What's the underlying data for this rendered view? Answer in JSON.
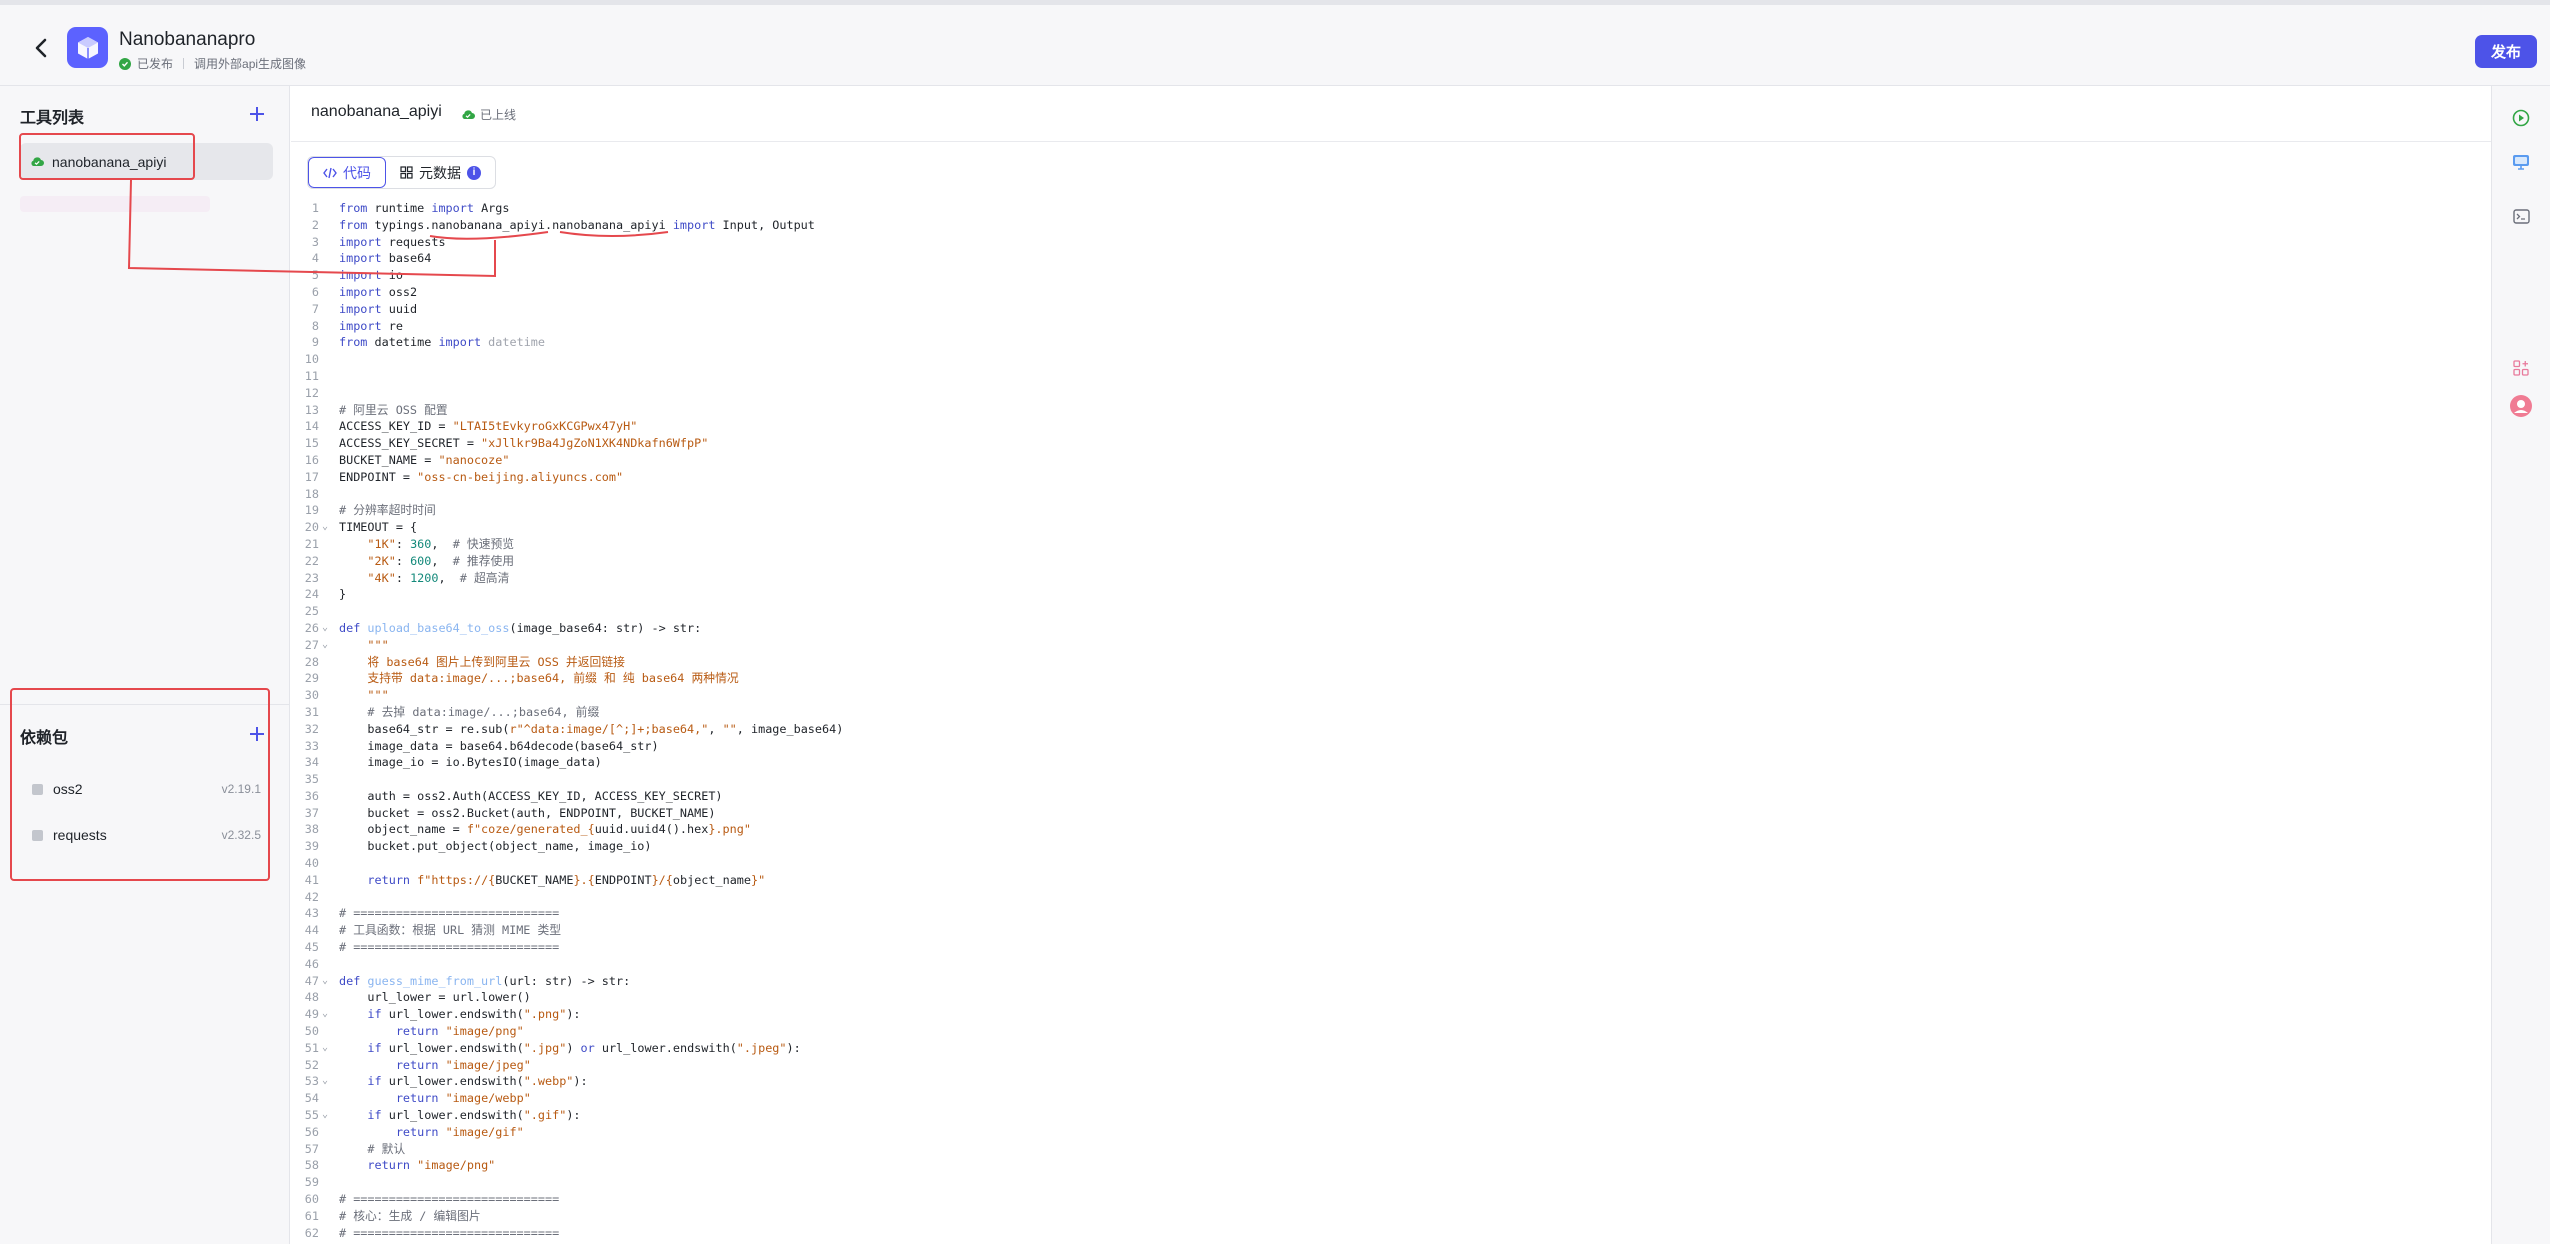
{
  "header": {
    "app_name": "Nanobananapro",
    "status_published": "已发布",
    "description": "调用外部api生成图像",
    "publish_label": "发布"
  },
  "sidebar": {
    "tools_title": "工具列表",
    "tools": [
      {
        "name": "nanobanana_apiyi"
      }
    ],
    "deps_title": "依赖包",
    "deps": [
      {
        "name": "oss2",
        "version": "v2.19.1"
      },
      {
        "name": "requests",
        "version": "v2.32.5"
      }
    ]
  },
  "editor": {
    "tool_name": "nanobanana_apiyi",
    "tool_status": "已上线",
    "tabs": [
      {
        "label": "代码"
      },
      {
        "label": "元数据"
      }
    ],
    "code_lines": [
      [
        [
          "kw",
          "from"
        ],
        [
          "t",
          " runtime "
        ],
        [
          "kw",
          "import"
        ],
        [
          "t",
          " Args"
        ]
      ],
      [
        [
          "kw",
          "from"
        ],
        [
          "t",
          " typings.nanobanana_apiyi.nanobanana_apiyi "
        ],
        [
          "kw",
          "import"
        ],
        [
          "t",
          " Input, Output"
        ]
      ],
      [
        [
          "kw",
          "import"
        ],
        [
          "t",
          " requests"
        ]
      ],
      [
        [
          "kw",
          "import"
        ],
        [
          "t",
          " base64"
        ]
      ],
      [
        [
          "kw",
          "import"
        ],
        [
          "t",
          " io"
        ]
      ],
      [
        [
          "kw",
          "import"
        ],
        [
          "t",
          " oss2"
        ]
      ],
      [
        [
          "kw",
          "import"
        ],
        [
          "t",
          " uuid"
        ]
      ],
      [
        [
          "kw",
          "import"
        ],
        [
          "t",
          " re"
        ]
      ],
      [
        [
          "kw",
          "from"
        ],
        [
          "t",
          " datetime "
        ],
        [
          "kw",
          "import"
        ],
        [
          "dim",
          " datetime"
        ]
      ],
      [],
      [],
      [],
      [
        [
          "cmt",
          "# 阿里云 OSS 配置"
        ]
      ],
      [
        [
          "t",
          "ACCESS_KEY_ID = "
        ],
        [
          "str",
          "\"LTAI5tEvkyroGxKCGPwx47yH\""
        ]
      ],
      [
        [
          "t",
          "ACCESS_KEY_SECRET = "
        ],
        [
          "str",
          "\"xJllkr9Ba4JgZoN1XK4NDkafn6WfpP\""
        ]
      ],
      [
        [
          "t",
          "BUCKET_NAME = "
        ],
        [
          "str",
          "\"nanocoze\""
        ]
      ],
      [
        [
          "t",
          "ENDPOINT = "
        ],
        [
          "str",
          "\"oss-cn-beijing.aliyuncs.com\""
        ]
      ],
      [],
      [
        [
          "cmt",
          "# 分辨率超时时间"
        ]
      ],
      [
        [
          "t",
          "TIMEOUT = {"
        ]
      ],
      [
        [
          "t",
          "    "
        ],
        [
          "str",
          "\"1K\""
        ],
        [
          "t",
          ": "
        ],
        [
          "num",
          "360"
        ],
        [
          "t",
          ",  "
        ],
        [
          "cmt",
          "# 快速预览"
        ]
      ],
      [
        [
          "t",
          "    "
        ],
        [
          "str",
          "\"2K\""
        ],
        [
          "t",
          ": "
        ],
        [
          "num",
          "600"
        ],
        [
          "t",
          ",  "
        ],
        [
          "cmt",
          "# 推荐使用"
        ]
      ],
      [
        [
          "t",
          "    "
        ],
        [
          "str",
          "\"4K\""
        ],
        [
          "t",
          ": "
        ],
        [
          "num",
          "1200"
        ],
        [
          "t",
          ",  "
        ],
        [
          "cmt",
          "# 超高清"
        ]
      ],
      [
        [
          "t",
          "}"
        ]
      ],
      [],
      [
        [
          "kw",
          "def"
        ],
        [
          "t",
          " "
        ],
        [
          "fn",
          "upload_base64_to_oss"
        ],
        [
          "t",
          "(image_base64: str) -> str:"
        ]
      ],
      [
        [
          "t",
          "    "
        ],
        [
          "str",
          "\"\"\""
        ]
      ],
      [
        [
          "t",
          "    "
        ],
        [
          "str",
          "将 base64 图片上传到阿里云 OSS 并返回链接"
        ]
      ],
      [
        [
          "t",
          "    "
        ],
        [
          "str",
          "支持带 data:image/...;base64, 前缀 和 纯 base64 两种情况"
        ]
      ],
      [
        [
          "t",
          "    "
        ],
        [
          "str",
          "\"\"\""
        ]
      ],
      [
        [
          "t",
          "    "
        ],
        [
          "cmt",
          "# 去掉 data:image/...;base64, 前缀"
        ]
      ],
      [
        [
          "t",
          "    base64_str = re.sub("
        ],
        [
          "str",
          "r\"^data:image/[^;]+;base64,\""
        ],
        [
          "t",
          ", "
        ],
        [
          "str",
          "\"\""
        ],
        [
          "t",
          ", image_base64)"
        ]
      ],
      [
        [
          "t",
          "    image_data = base64.b64decode(base64_str)"
        ]
      ],
      [
        [
          "t",
          "    image_io = io.BytesIO(image_data)"
        ]
      ],
      [],
      [
        [
          "t",
          "    auth = oss2.Auth(ACCESS_KEY_ID, ACCESS_KEY_SECRET)"
        ]
      ],
      [
        [
          "t",
          "    bucket = oss2.Bucket(auth, ENDPOINT, BUCKET_NAME)"
        ]
      ],
      [
        [
          "t",
          "    object_name = "
        ],
        [
          "str",
          "f\"coze/generated_{"
        ],
        [
          "t",
          "uuid.uuid4().hex"
        ],
        [
          "str",
          "}.png\""
        ]
      ],
      [
        [
          "t",
          "    bucket.put_object(object_name, image_io)"
        ]
      ],
      [],
      [
        [
          "t",
          "    "
        ],
        [
          "kw",
          "return"
        ],
        [
          "t",
          " "
        ],
        [
          "str",
          "f\"https://{"
        ],
        [
          "t",
          "BUCKET_NAME"
        ],
        [
          "str",
          "}.{"
        ],
        [
          "t",
          "ENDPOINT"
        ],
        [
          "str",
          "}/{"
        ],
        [
          "t",
          "object_name"
        ],
        [
          "str",
          "}\""
        ]
      ],
      [],
      [
        [
          "cmt",
          "# ============================="
        ]
      ],
      [
        [
          "cmt",
          "# 工具函数：根据 URL 猜测 MIME 类型"
        ]
      ],
      [
        [
          "cmt",
          "# ============================="
        ]
      ],
      [],
      [
        [
          "kw",
          "def"
        ],
        [
          "t",
          " "
        ],
        [
          "fn",
          "guess_mime_from_url"
        ],
        [
          "t",
          "(url: str) -> str:"
        ]
      ],
      [
        [
          "t",
          "    url_lower = url.lower()"
        ]
      ],
      [
        [
          "t",
          "    "
        ],
        [
          "kw",
          "if"
        ],
        [
          "t",
          " url_lower.endswith("
        ],
        [
          "str",
          "\".png\""
        ],
        [
          "t",
          "):"
        ]
      ],
      [
        [
          "t",
          "        "
        ],
        [
          "kw",
          "return"
        ],
        [
          "t",
          " "
        ],
        [
          "str",
          "\"image/png\""
        ]
      ],
      [
        [
          "t",
          "    "
        ],
        [
          "kw",
          "if"
        ],
        [
          "t",
          " url_lower.endswith("
        ],
        [
          "str",
          "\".jpg\""
        ],
        [
          "t",
          ") "
        ],
        [
          "kw",
          "or"
        ],
        [
          "t",
          " url_lower.endswith("
        ],
        [
          "str",
          "\".jpeg\""
        ],
        [
          "t",
          "):"
        ]
      ],
      [
        [
          "t",
          "        "
        ],
        [
          "kw",
          "return"
        ],
        [
          "t",
          " "
        ],
        [
          "str",
          "\"image/jpeg\""
        ]
      ],
      [
        [
          "t",
          "    "
        ],
        [
          "kw",
          "if"
        ],
        [
          "t",
          " url_lower.endswith("
        ],
        [
          "str",
          "\".webp\""
        ],
        [
          "t",
          "):"
        ]
      ],
      [
        [
          "t",
          "        "
        ],
        [
          "kw",
          "return"
        ],
        [
          "t",
          " "
        ],
        [
          "str",
          "\"image/webp\""
        ]
      ],
      [
        [
          "t",
          "    "
        ],
        [
          "kw",
          "if"
        ],
        [
          "t",
          " url_lower.endswith("
        ],
        [
          "str",
          "\".gif\""
        ],
        [
          "t",
          "):"
        ]
      ],
      [
        [
          "t",
          "        "
        ],
        [
          "kw",
          "return"
        ],
        [
          "t",
          " "
        ],
        [
          "str",
          "\"image/gif\""
        ]
      ],
      [
        [
          "t",
          "    "
        ],
        [
          "cmt",
          "# 默认"
        ]
      ],
      [
        [
          "t",
          "    "
        ],
        [
          "kw",
          "return"
        ],
        [
          "t",
          " "
        ],
        [
          "str",
          "\"image/png\""
        ]
      ],
      [],
      [
        [
          "cmt",
          "# ============================="
        ]
      ],
      [
        [
          "cmt",
          "# 核心：生成 / 编辑图片"
        ]
      ],
      [
        [
          "cmt",
          "# ============================="
        ]
      ]
    ],
    "fold_lines": [
      20,
      26,
      27,
      47,
      49,
      51,
      53,
      55
    ]
  },
  "colors": {
    "accent": "#4d53e8",
    "success": "#32a645",
    "annotation_red": "#e5484d"
  },
  "icons": {
    "back": "chevron-left-icon",
    "logo": "cube-icon",
    "cloud": "cloud-check-icon",
    "code_tab": "code-icon",
    "meta_tab": "grid-icon",
    "rail": [
      "run-icon",
      "monitor-icon",
      "terminal-icon",
      "apps-icon",
      "avatar-icon"
    ]
  }
}
